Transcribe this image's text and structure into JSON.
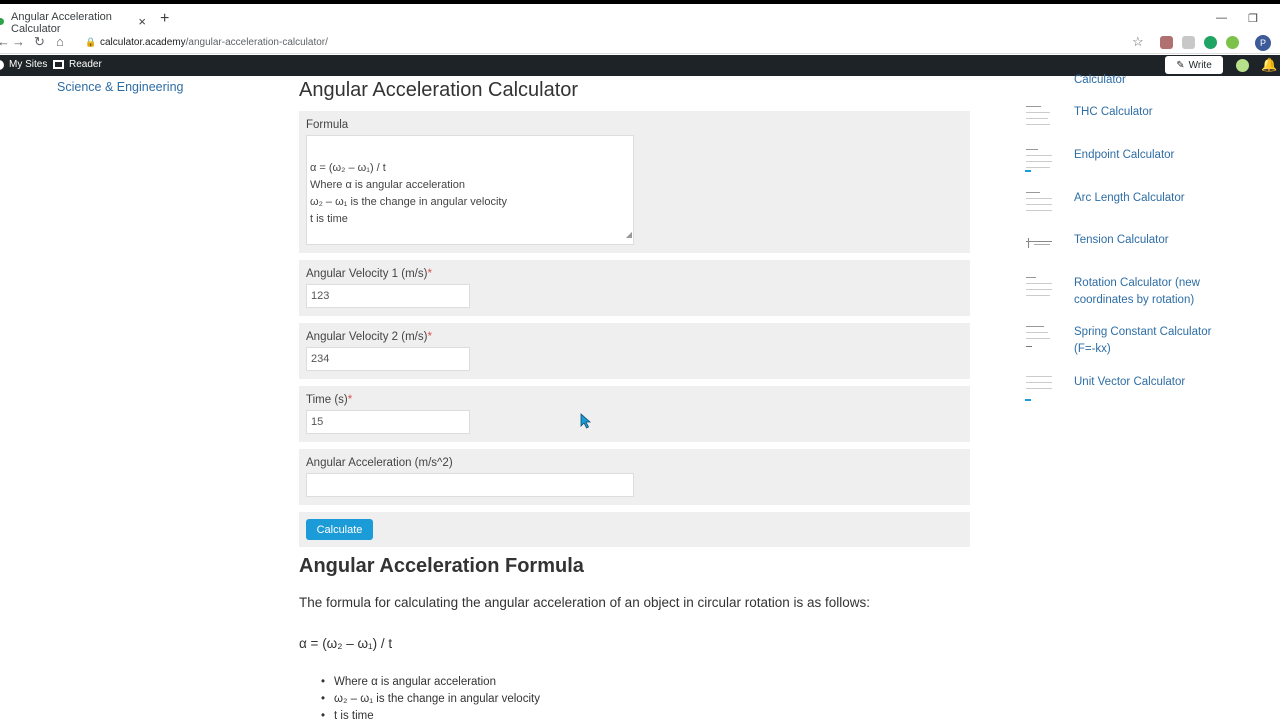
{
  "browser": {
    "tab_title": "Angular Acceleration Calculator",
    "tab_close": "×",
    "new_tab": "+",
    "url_host": "calculator.academy",
    "url_path": "/angular-acceleration-calculator/",
    "profile_initial": "P"
  },
  "wp_bar": {
    "my_sites": "My Sites",
    "reader": "Reader",
    "write": "Write"
  },
  "left_nav": {
    "link": "Science & Engineering"
  },
  "calculator": {
    "title": "Angular Acceleration Calculator",
    "formula_label": "Formula",
    "formula_lines": [
      "α = (ω₂ – ω₁) / t",
      "Where α is angular acceleration",
      "ω₂ – ω₁ is the change in angular velocity",
      "t is time"
    ],
    "fields": [
      {
        "label": "Angular Velocity 1 (m/s)",
        "required": "*",
        "value": "123"
      },
      {
        "label": "Angular Velocity 2 (m/s)",
        "required": "*",
        "value": "234"
      },
      {
        "label": "Time (s)",
        "required": "*",
        "value": "15"
      }
    ],
    "result_label": "Angular Acceleration (m/s^2)",
    "result_value": "",
    "calculate_button": "Calculate"
  },
  "article": {
    "heading": "Angular Acceleration Formula",
    "intro": "The formula for calculating the angular acceleration of an object in circular rotation is as follows:",
    "formula": "α = (ω₂ – ω₁) / t",
    "bullets": [
      "Where α is angular acceleration",
      "ω₂ – ω₁ is the change in angular velocity",
      "t is time"
    ]
  },
  "sidebar": {
    "items": [
      {
        "label": "Calculator"
      },
      {
        "label": "THC Calculator"
      },
      {
        "label": "Endpoint Calculator"
      },
      {
        "label": "Arc Length Calculator"
      },
      {
        "label": "Tension Calculator"
      },
      {
        "label": "Rotation Calculator (new coordinates by rotation)"
      },
      {
        "label": "Spring Constant Calculator (F=-kx)"
      },
      {
        "label": "Unit Vector Calculator"
      }
    ]
  },
  "colors": {
    "link": "#2e6da4",
    "button": "#1b9bd8",
    "panel": "#efefef",
    "required": "#d9534f"
  }
}
